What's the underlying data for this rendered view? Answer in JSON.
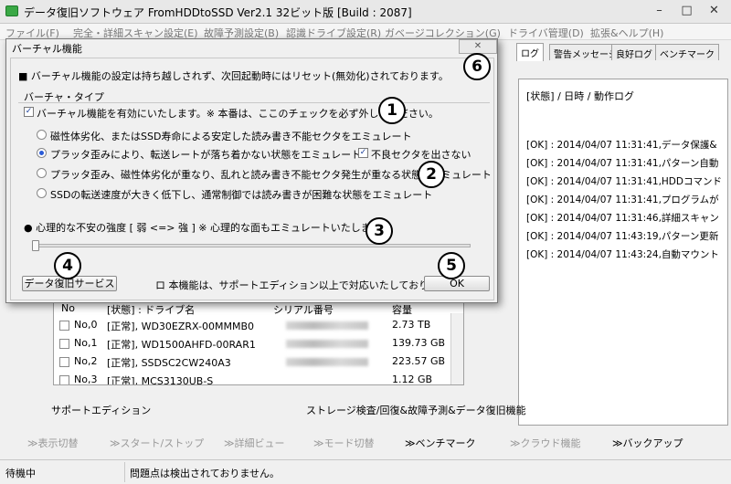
{
  "window": {
    "title": "データ復旧ソフトウェア FromHDDtoSSD Ver2.1 32ビット版 [Build : 2087]",
    "controls": {
      "minimize": "–",
      "maximize": "□",
      "close": "✕"
    }
  },
  "menu": [
    "ファイル(F)",
    "完全・詳細スキャン設定(E)",
    "故障予測設定(B)",
    "認識ドライブ設定(R)",
    "ガベージコレクション(G)",
    "ドライバ管理(D)",
    "拡張&ヘルプ(H)"
  ],
  "log_panel": {
    "tabs": [
      "ログ",
      "警告メッセージ",
      "良好ログ",
      "ベンチマーク"
    ],
    "header": "[状態] / 日時 / 動作ログ",
    "lines": [
      "[OK] : 2014/04/07 11:31:41,データ保護&",
      "[OK] : 2014/04/07 11:31:41,パターン自動",
      "[OK] : 2014/04/07 11:31:41,HDDコマンド",
      "[OK] : 2014/04/07 11:31:41,プログラムが",
      "[OK] : 2014/04/07 11:31:46,詳細スキャン",
      "[OK] : 2014/04/07 11:43:19,パターン更新",
      "[OK] : 2014/04/07 11:43:24,自動マウント"
    ]
  },
  "drive_table": {
    "headers": [
      "No",
      "[状態] : ドライブ名",
      "シリアル番号",
      "容量"
    ],
    "rows": [
      {
        "no": "No,0",
        "name": "[正常], WD30EZRX-00MMMB0",
        "capacity": "2.73 TB"
      },
      {
        "no": "No,1",
        "name": "[正常], WD1500AHFD-00RAR1",
        "capacity": "139.73 GB"
      },
      {
        "no": "No,2",
        "name": "[正常], SSDSC2CW240A3",
        "capacity": "223.57 GB"
      },
      {
        "no": "No,3",
        "name": "[正常], MCS3130UB-S",
        "capacity": "1.12 GB"
      }
    ]
  },
  "footer_labels": {
    "edition": "サポートエディション",
    "features": "ストレージ検査/回復&故障予測&データ復旧機能"
  },
  "toolbar": [
    "≫表示切替",
    "≫スタート/ストップ",
    "≫詳細ビュー",
    "≫モード切替",
    "≫ベンチマーク",
    "≫クラウド機能",
    "≫バックアップ"
  ],
  "status": {
    "state": "待機中",
    "message": "問題点は検出されておりません。"
  },
  "dialog": {
    "title": "バーチャル機能",
    "close": "✕",
    "notice": "■ バーチャル機能の設定は持ち越しされず、次回起動時にはリセット(無効化)されております。",
    "group_title": "バーチャ・タイプ",
    "enable_label": "バーチャル機能を有効にいたします。※ 本番は、ここのチェックを必ず外してください。",
    "options": [
      "磁性体劣化、またはSSD寿命による安定した読み書き不能セクタをエミュレート",
      "プラッタ歪みにより、転送レートが落ち着かない状態をエミュレート",
      "プラッタ歪み、磁性体劣化が重なり、乱れと読み書き不能セクタ発生が重なる状態をエミュレート",
      "SSDの転送速度が大きく低下し、通常制御では読み書きが困難な状態をエミュレート"
    ],
    "no_bad_sector_label": "不良セクタを出さない",
    "intensity_label": "● 心理的な不安の強度 [ 弱 <=> 強 ] ※ 心理的な面もエミュレートいたします。",
    "recovery_button": "データ復旧サービス",
    "support_note": "ロ 本機能は、サポートエディション以上で対応いたしております。",
    "ok_button": "OK"
  },
  "callouts": [
    "1",
    "2",
    "3",
    "4",
    "5",
    "6"
  ]
}
